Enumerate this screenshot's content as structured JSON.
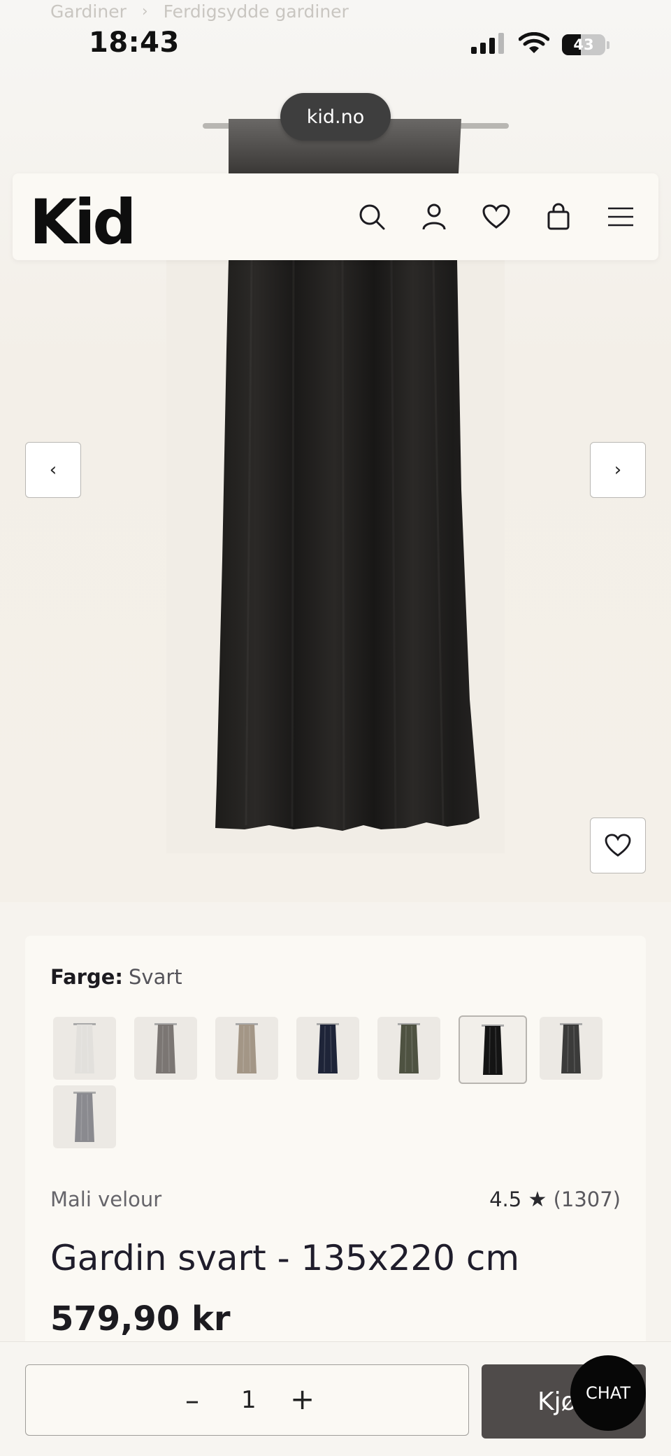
{
  "breadcrumb": {
    "items": [
      "Gardiner",
      "Ferdigsydde gardiner"
    ],
    "separator": "›"
  },
  "status_bar": {
    "time": "18:43",
    "battery": "43",
    "battery_level": 0.43
  },
  "browser": {
    "url": "kid.no"
  },
  "header": {
    "logo": "Kid",
    "icons": [
      "search-icon",
      "account-icon",
      "wishlist-heart-icon",
      "shopping-bag-icon",
      "menu-hamburger-icon"
    ]
  },
  "gallery": {
    "prev_label": "‹",
    "next_label": "›",
    "favorite_icon": "heart-icon"
  },
  "product": {
    "color_label": "Farge:",
    "color_value": "Svart",
    "swatches": [
      {
        "name": "hvit",
        "color": "#e2e0dc",
        "selected": false
      },
      {
        "name": "grå-brun",
        "color": "#7b7673",
        "selected": false
      },
      {
        "name": "beige",
        "color": "#a39686",
        "selected": false
      },
      {
        "name": "mørkeblå",
        "color": "#1e2438",
        "selected": false
      },
      {
        "name": "grønn",
        "color": "#4e5241",
        "selected": false
      },
      {
        "name": "svart",
        "color": "#141414",
        "selected": true
      },
      {
        "name": "antrasitt",
        "color": "#3b3b3a",
        "selected": false
      },
      {
        "name": "grå",
        "color": "#8a8a8f",
        "selected": false
      }
    ],
    "brand": "Mali velour",
    "rating": "4.5",
    "star": "★",
    "review_count": "(1307)",
    "title": "Gardin svart - 135x220 cm",
    "price": "579,90 kr"
  },
  "purchase": {
    "minus_label": "–",
    "quantity": "1",
    "plus_label": "+",
    "buy_label": "Kjøp",
    "chat_label": "CHAT"
  },
  "colors": {
    "background": "#f6f3ee",
    "card": "#fbf9f4",
    "buy_button": "#4f4b4a",
    "chat_button": "#070707"
  }
}
